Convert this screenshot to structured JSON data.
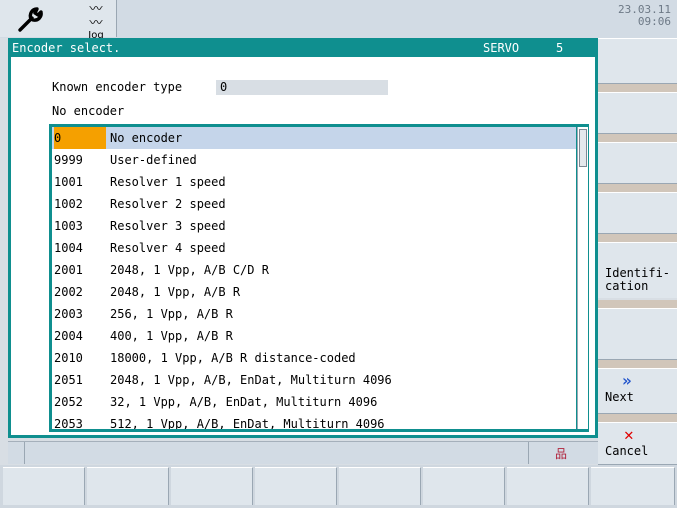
{
  "header": {
    "mode_icon": "jog-wave-icon",
    "mode_label": "Jog",
    "date": "23.03.11",
    "time": "09:06"
  },
  "dialog": {
    "title": "Encoder select.",
    "servo_label": "SERVO",
    "servo_number": "5",
    "known_label": "Known encoder type",
    "known_value": "0",
    "current_name": "No encoder",
    "selected_index": 0,
    "rows": [
      {
        "code": "0",
        "desc": "No encoder"
      },
      {
        "code": "9999",
        "desc": "User-defined"
      },
      {
        "code": "1001",
        "desc": "Resolver 1 speed"
      },
      {
        "code": "1002",
        "desc": "Resolver 2 speed"
      },
      {
        "code": "1003",
        "desc": "Resolver 3 speed"
      },
      {
        "code": "1004",
        "desc": "Resolver 4 speed"
      },
      {
        "code": "2001",
        "desc": "2048, 1 Vpp, A/B C/D R"
      },
      {
        "code": "2002",
        "desc": "2048, 1 Vpp, A/B R"
      },
      {
        "code": "2003",
        "desc": "256, 1 Vpp, A/B R"
      },
      {
        "code": "2004",
        "desc": "400, 1 Vpp, A/B R"
      },
      {
        "code": "2010",
        "desc": "18000, 1 Vpp, A/B R distance-coded"
      },
      {
        "code": "2051",
        "desc": "2048, 1 Vpp, A/B, EnDat, Multiturn 4096"
      },
      {
        "code": "2052",
        "desc": "32, 1 Vpp, A/B, EnDat, Multiturn 4096"
      },
      {
        "code": "2053",
        "desc": "512, 1 Vpp, A/B, EnDat, Multiturn 4096"
      }
    ]
  },
  "softkeys": {
    "identification": "Identifi-\ncation",
    "next": "Next",
    "next_icon": "double-chevron-right-icon",
    "cancel": "Cancel",
    "cancel_icon": "red-x-icon"
  },
  "colors": {
    "accent": "#0f8f8f",
    "selection_code": "#f5a000",
    "selection_row": "#c5d5ea"
  }
}
